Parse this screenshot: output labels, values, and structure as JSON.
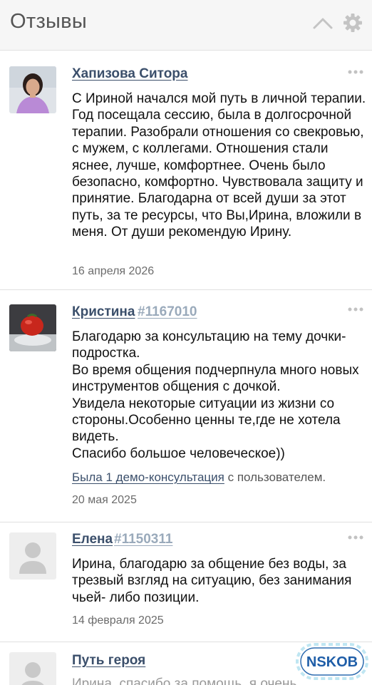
{
  "header": {
    "title": "Отзывы"
  },
  "reviews": [
    {
      "author": "Хапизова Ситора",
      "author_id": "",
      "text": "С Ириной начался мой путь в личной терапии. Год посещала сессию, была в долгосрочной терапии. Разобрали отношения со свекровью, с мужем, с коллегами. Отношения стали яснее, лучше, комфортнее. Очень было безопасно, комфортно. Чувствовала защиту и принятие. Благодарна от всей души за этот путь, за те ресурсы, что Вы,Ирина, вложили в меня. От души рекомендую Ирину.",
      "date": "16 апреля 2026"
    },
    {
      "author": "Кристина",
      "author_id": "#1167010",
      "text": "Благодарю за консультацию на тему дочки-подростка.\nВо время общения подчерпнула много новых инструментов общения с дочкой.\nУвидела некоторые ситуации из жизни со стороны.Особенно ценны те,где не хотела видеть.\nСпасибо большое человеческое))",
      "demo_link": "Была 1 демо-консультация",
      "demo_suffix": " с пользователем.",
      "date": "20 мая 2025"
    },
    {
      "author": "Елена",
      "author_id": "#1150311",
      "text": "Ирина, благодарю за общение без воды, за трезвый взгляд на ситуацию, без занимания чьей- либо позиции.",
      "date": "14 февраля 2025"
    },
    {
      "author": "Путь героя",
      "author_id": "",
      "text": "Ирина, спасибо за помощь, я очень"
    }
  ],
  "watermark": {
    "label": "NSKOB"
  },
  "colors": {
    "link": "#3b4f6b",
    "id": "#9aaabb",
    "date": "#6b6b6b"
  }
}
